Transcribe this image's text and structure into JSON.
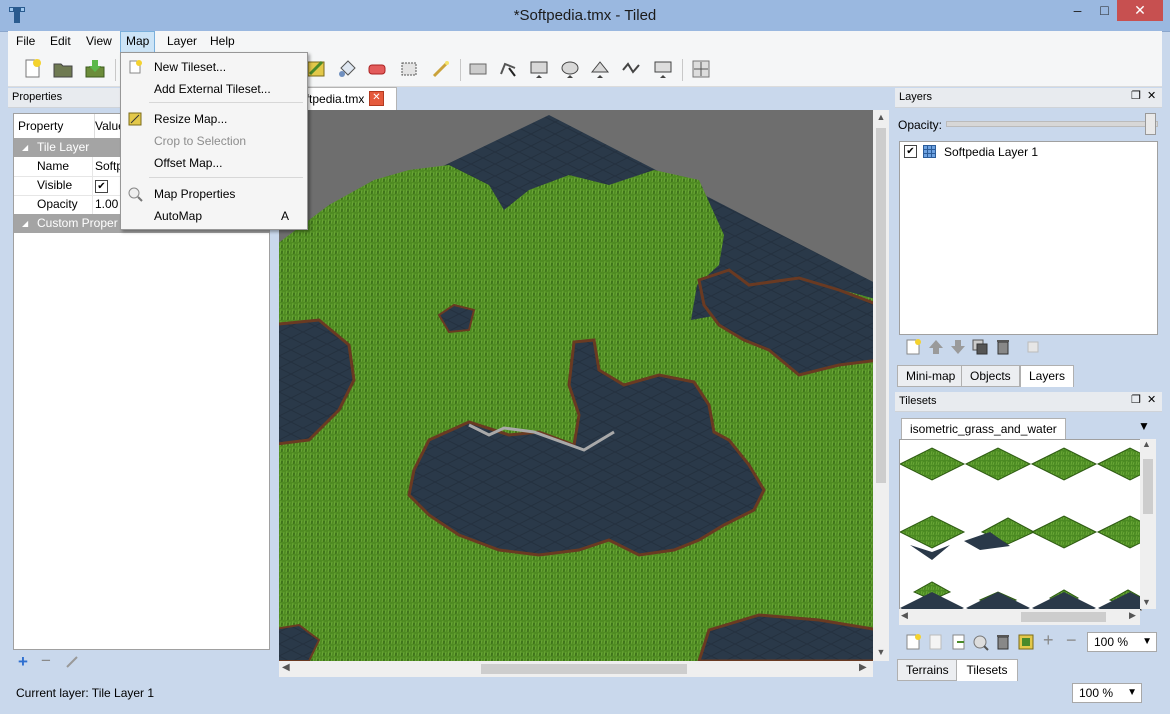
{
  "window": {
    "title": "*Softpedia.tmx - Tiled",
    "minimize": "–",
    "maximize": "□",
    "close": "✕"
  },
  "menubar": [
    "File",
    "Edit",
    "View",
    "Map",
    "Layer",
    "Help"
  ],
  "map_menu": {
    "items": [
      {
        "label": "New Tileset...",
        "icon": "new-tileset-icon"
      },
      {
        "label": "Add External Tileset..."
      },
      {
        "label": "Resize Map...",
        "icon": "resize-map-icon"
      },
      {
        "label": "Crop to Selection",
        "disabled": true
      },
      {
        "label": "Offset Map..."
      },
      {
        "label": "Map Properties",
        "icon": "map-properties-icon"
      },
      {
        "label": "AutoMap",
        "shortcut": "A"
      }
    ]
  },
  "properties": {
    "title": "Properties",
    "col_property": "Property",
    "col_value": "Value",
    "group_tile_layer": "Tile Layer",
    "rows": [
      {
        "name": "Name",
        "value": "Softp"
      },
      {
        "name": "Visible",
        "value": "✔"
      },
      {
        "name": "Opacity",
        "value": "1.00"
      }
    ],
    "group_custom": "Custom Proper"
  },
  "document_tab": {
    "label": "oftpedia.tmx"
  },
  "layers_panel": {
    "title": "Layers",
    "opacity_label": "Opacity:",
    "opacity": 1.0,
    "layers": [
      {
        "name": "Softpedia Layer 1",
        "visible": true
      }
    ],
    "tabs": [
      "Mini-map",
      "Objects",
      "Layers"
    ],
    "selected_tab": "Layers"
  },
  "tilesets_panel": {
    "title": "Tilesets",
    "tileset_name": "isometric_grass_and_water",
    "zoom": "100 %",
    "tabs": [
      "Terrains",
      "Tilesets"
    ],
    "selected_tab": "Tilesets"
  },
  "status": {
    "current_layer": "Current layer: Tile Layer 1",
    "zoom": "100 %"
  },
  "colors": {
    "accent": "#cce4f7",
    "close": "#c75050",
    "grass": "#4d8a1f",
    "water": "#2b3a4a",
    "dirt": "#6a3a22"
  }
}
